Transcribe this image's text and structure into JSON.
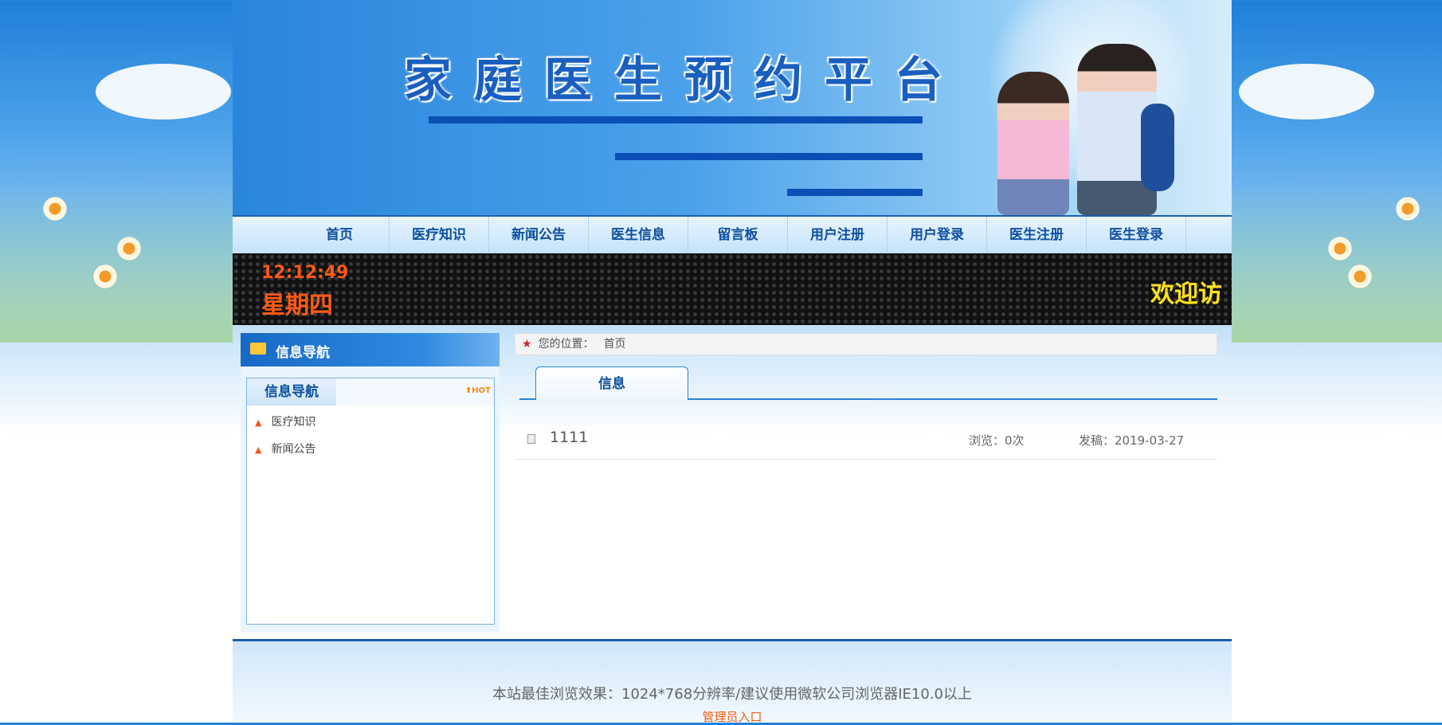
{
  "header": {
    "site_title": "家庭医生预约平台"
  },
  "nav": {
    "items": [
      {
        "label": "首页"
      },
      {
        "label": "医疗知识"
      },
      {
        "label": "新闻公告"
      },
      {
        "label": "医生信息"
      },
      {
        "label": "留言板"
      },
      {
        "label": "用户注册"
      },
      {
        "label": "用户登录"
      },
      {
        "label": "医生注册"
      },
      {
        "label": "医生登录"
      }
    ]
  },
  "ticker": {
    "time": "12:12:49",
    "weekday": "星期四",
    "welcome": "欢迎访"
  },
  "sidebar": {
    "header_title": "信息导航",
    "tab_label": "信息导航",
    "hot_badge": "HOT",
    "items": [
      {
        "label": "医疗知识"
      },
      {
        "label": "新闻公告"
      }
    ]
  },
  "breadcrumb": {
    "prefix": "您的位置：",
    "current": "首页"
  },
  "main": {
    "tab_label": "信息",
    "rows": [
      {
        "title": "1111",
        "views": "浏览：0次",
        "date": "发稿：2019-03-27"
      }
    ]
  },
  "footer": {
    "text": "本站最佳浏览效果：1024*768分辨率/建议使用微软公司浏览器IE10.0以上",
    "admin_link": "管理员入口"
  },
  "colors": {
    "brand_blue": "#0d4f9f",
    "accent_orange": "#ff5a14",
    "welcome_yellow": "#ffe21a"
  }
}
